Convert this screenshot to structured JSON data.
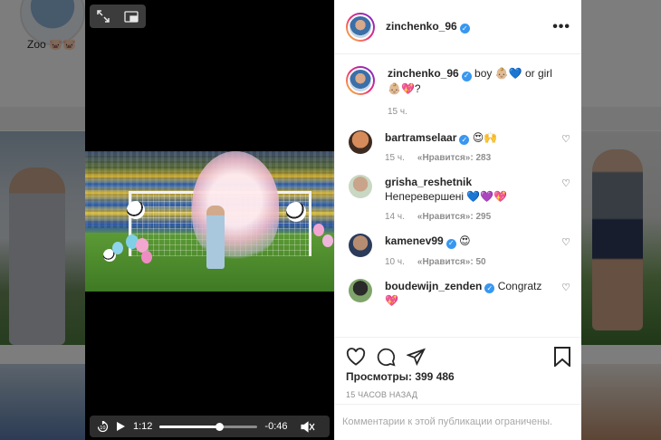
{
  "background": {
    "highlight_label": "Zoo 🐷🐷"
  },
  "video": {
    "current_time": "1:12",
    "remaining_time": "-0:46",
    "progress": 0.61
  },
  "post": {
    "author": "zinchenko_96",
    "caption_text": "boy 👶🏼💙 or girl 👶🏼💖?",
    "caption_time": "15 ч.",
    "views_label": "Просмотры: 399 486",
    "time_ago": "15 ЧАСОВ НАЗАД",
    "comments_restricted": "Комментарии к этой публикации ограничены."
  },
  "comments": [
    {
      "username": "bartramselaar",
      "text": "😍🙌",
      "time": "15 ч.",
      "likes": "«Нравится»: 283"
    },
    {
      "username": "grisha_reshetnik",
      "text": "Неперевершені 💙💜💖",
      "time": "14 ч.",
      "likes": "«Нравится»: 295"
    },
    {
      "username": "kamenev99",
      "text": "😍",
      "time": "10 ч.",
      "likes": "«Нравится»: 50"
    },
    {
      "username": "boudewijn_zenden",
      "text": "Congratz 💖",
      "time": "",
      "likes": ""
    }
  ],
  "colors": {
    "verified": "#3897f0",
    "text": "#262626",
    "muted": "#8e8e8e"
  }
}
